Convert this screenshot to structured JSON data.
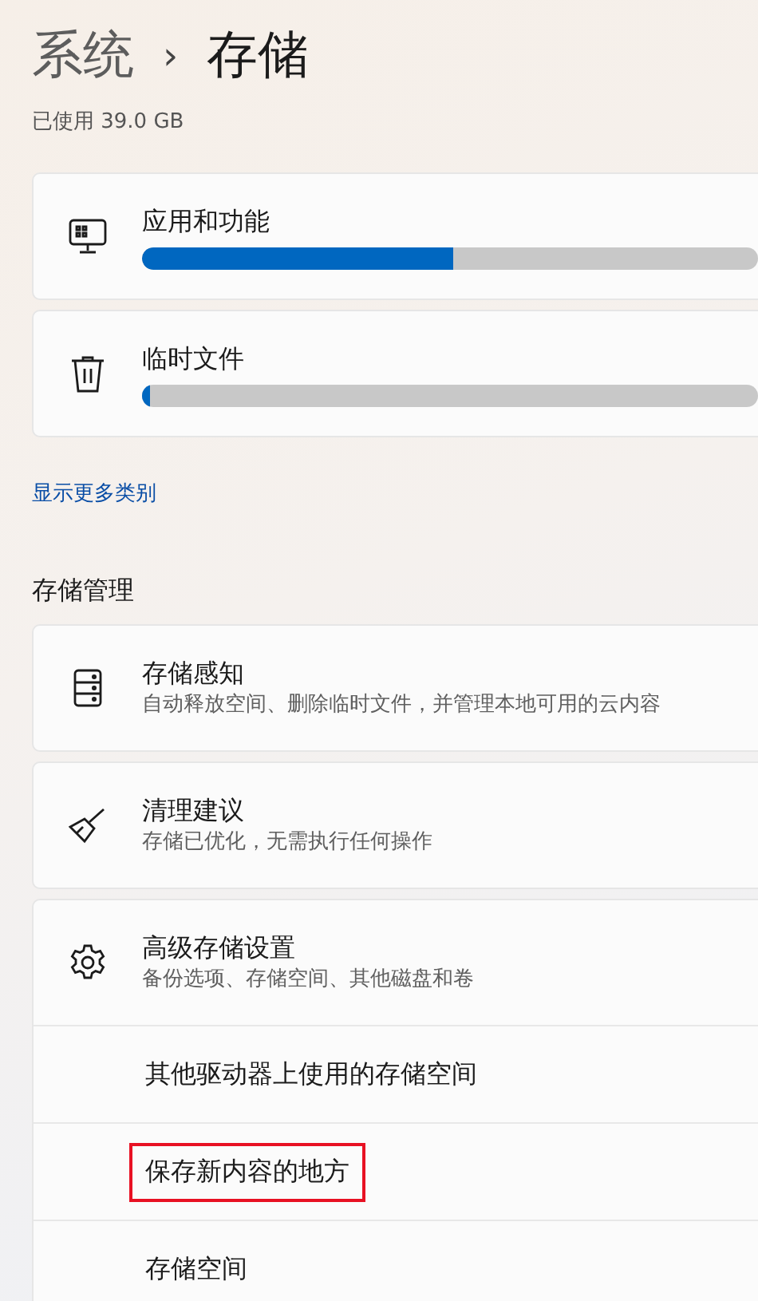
{
  "breadcrumb": {
    "parent": "系统",
    "separator": "›",
    "current": "存储"
  },
  "usage": "已使用 39.0 GB",
  "categories": [
    {
      "title": "应用和功能",
      "level": 0.505
    },
    {
      "title": "临时文件",
      "level": 0.012
    }
  ],
  "more_link": "显示更多类别",
  "section_title": "存储管理",
  "settings": [
    {
      "title": "存储感知",
      "subtitle": "自动释放空间、删除临时文件，并管理本地可用的云内容"
    },
    {
      "title": "清理建议",
      "subtitle": "存储已优化，无需执行任何操作"
    },
    {
      "title": "高级存储设置",
      "subtitle": "备份选项、存储空间、其他磁盘和卷",
      "children": [
        {
          "title": "其他驱动器上使用的存储空间",
          "highlighted": false
        },
        {
          "title": "保存新内容的地方",
          "highlighted": true
        },
        {
          "title": "存储空间",
          "highlighted": false
        }
      ]
    }
  ]
}
